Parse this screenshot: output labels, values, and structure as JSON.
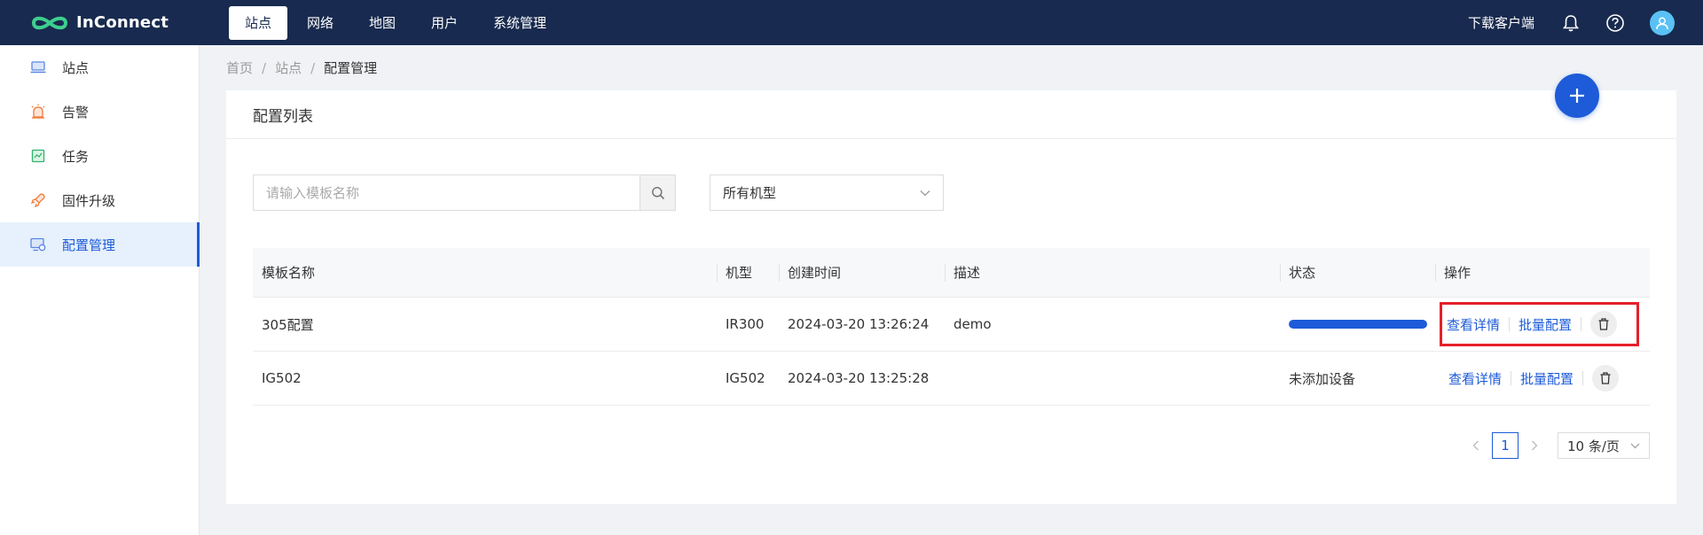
{
  "app": {
    "name": "InConnect"
  },
  "nav": {
    "items": [
      {
        "label": "站点",
        "active": true
      },
      {
        "label": "网络"
      },
      {
        "label": "地图"
      },
      {
        "label": "用户"
      },
      {
        "label": "系统管理"
      }
    ],
    "download": "下载客户端"
  },
  "sidebar": {
    "items": [
      {
        "label": "站点",
        "icon": "site-icon"
      },
      {
        "label": "告警",
        "icon": "alarm-icon"
      },
      {
        "label": "任务",
        "icon": "task-icon"
      },
      {
        "label": "固件升级",
        "icon": "firmware-icon"
      },
      {
        "label": "配置管理",
        "icon": "config-icon",
        "active": true
      }
    ]
  },
  "breadcrumb": [
    "首页",
    "站点",
    "配置管理"
  ],
  "card": {
    "title": "配置列表",
    "search_placeholder": "请输入模板名称",
    "model_select": "所有机型"
  },
  "table": {
    "headers": [
      "模板名称",
      "机型",
      "创建时间",
      "描述",
      "状态",
      "操作"
    ],
    "rows": [
      {
        "name": "305配置",
        "model": "IR300",
        "created": "2024-03-20 13:26:24",
        "desc": "demo",
        "status": "",
        "status_progress": 1.0
      },
      {
        "name": "IG502",
        "model": "IG502",
        "created": "2024-03-20 13:25:28",
        "desc": "",
        "status": "未添加设备"
      }
    ],
    "actions": {
      "view": "查看详情",
      "batch": "批量配置"
    }
  },
  "pagination": {
    "current": "1",
    "page_size": "10 条/页"
  },
  "colors": {
    "topbar": "#182a4f",
    "accent": "#1d5bd8",
    "highlight": "#e5202a"
  }
}
